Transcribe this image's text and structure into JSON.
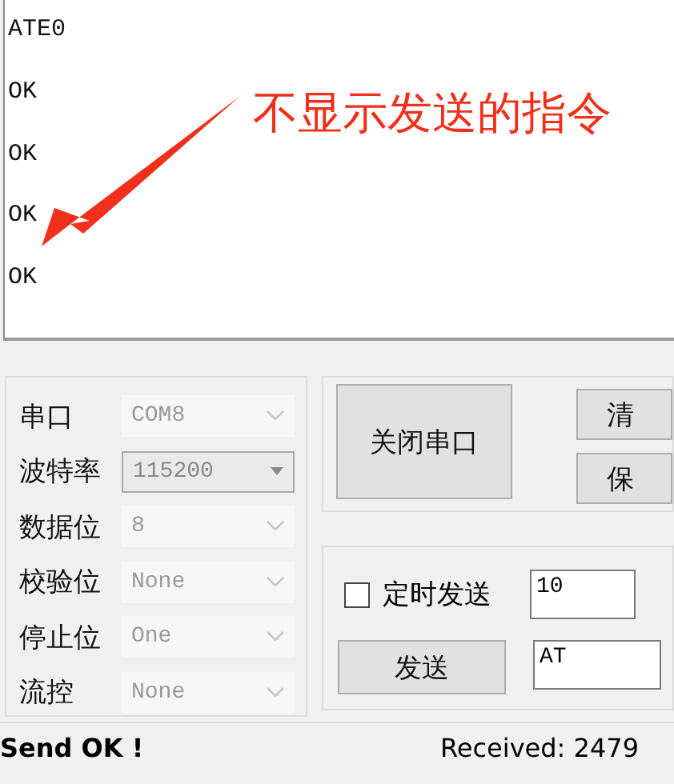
{
  "receive_log": {
    "lines": [
      "ATE0",
      "OK",
      "OK",
      "OK",
      "OK"
    ]
  },
  "annotation": {
    "text": "不显示发送的指令"
  },
  "port_settings": [
    {
      "label": "串口",
      "value": "COM8",
      "disabled": true
    },
    {
      "label": "波特率",
      "value": "115200",
      "disabled": false
    },
    {
      "label": "数据位",
      "value": "8",
      "disabled": true
    },
    {
      "label": "校验位",
      "value": "None",
      "disabled": true
    },
    {
      "label": "停止位",
      "value": "One",
      "disabled": true
    },
    {
      "label": "流控",
      "value": "None",
      "disabled": true
    }
  ],
  "open_close_button": "关闭串口",
  "side_buttons": [
    "清",
    "保"
  ],
  "timed_send": {
    "label": "定时发送",
    "checked": false,
    "interval": "10"
  },
  "send_button": "发送",
  "send_input": "AT",
  "status_bar": {
    "message": "Send OK !",
    "received": "Received: 2479"
  }
}
